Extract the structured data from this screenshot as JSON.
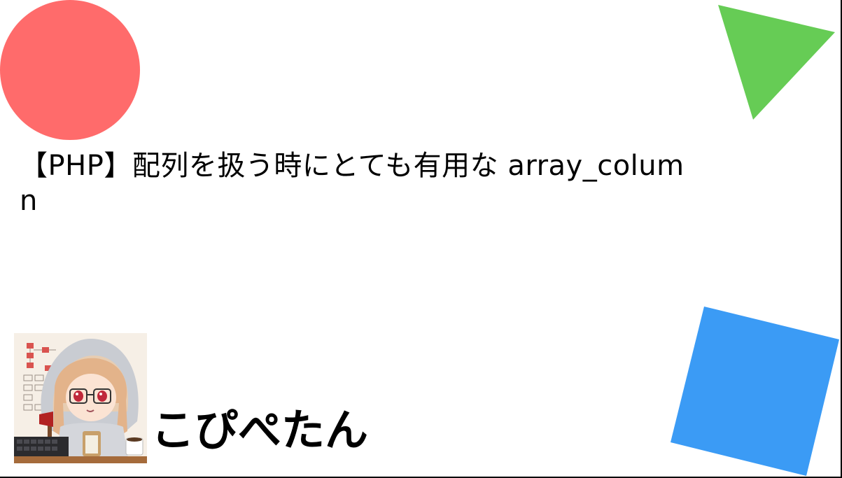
{
  "card": {
    "title": "【PHP】配列を扱う時にとても有用な array_column",
    "author_name": "こぴぺたん"
  },
  "colors": {
    "circle": "#ff6b6b",
    "triangle": "#66cc55",
    "square": "#3b9bf5",
    "background": "#ffffff",
    "text": "#000000"
  },
  "decorations": [
    "circle",
    "triangle",
    "square"
  ]
}
